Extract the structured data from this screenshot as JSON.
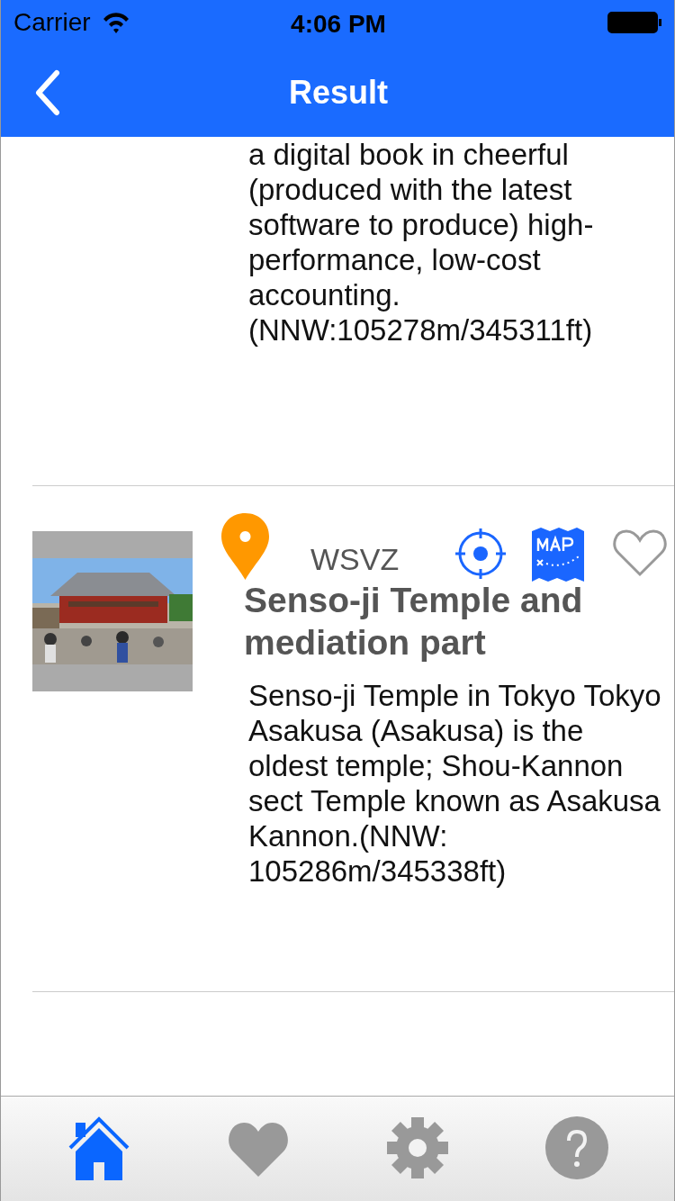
{
  "status_bar": {
    "carrier": "Carrier",
    "time": "4:06 PM"
  },
  "nav_bar": {
    "title": "Result"
  },
  "results": [
    {
      "description": "a digital book in cheerful (produced with the latest software to produce) high-performance, low-cost accounting.(NNW:105278m/345311ft)"
    },
    {
      "code": "WSVZ",
      "title": "Senso-ji Temple and mediation part",
      "description": "Senso-ji Temple in Tokyo Tokyo Asakusa (Asakusa) is the oldest temple; Shou-Kannon sect Temple known as Asakusa Kannon.(NNW: 105286m/345338ft)",
      "favorite": false
    }
  ],
  "tab_bar": [
    {
      "kind": "home",
      "selected": true
    },
    {
      "kind": "favorites",
      "selected": false
    },
    {
      "kind": "settings",
      "selected": false
    },
    {
      "kind": "help",
      "selected": false
    }
  ]
}
